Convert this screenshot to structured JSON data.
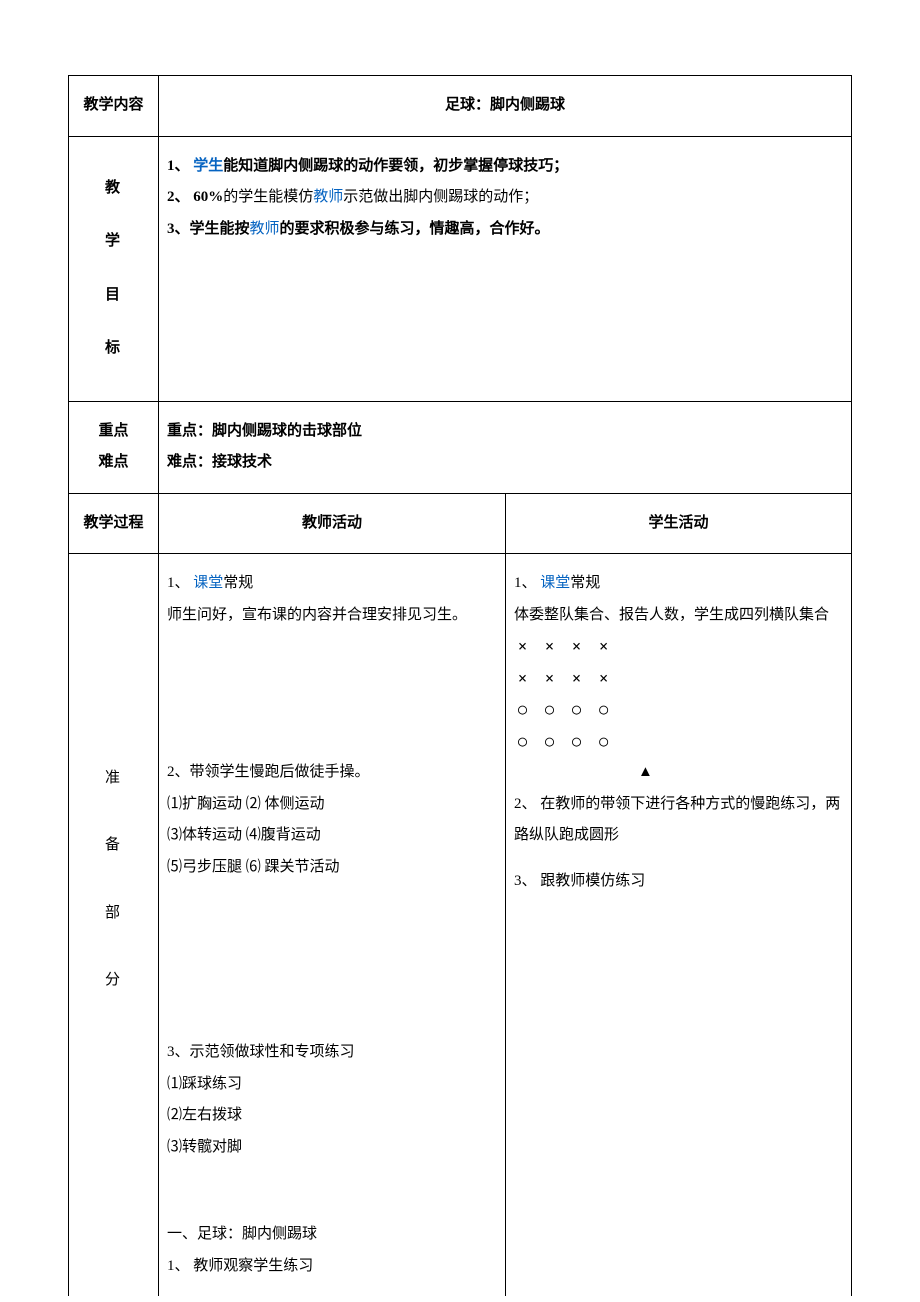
{
  "r1": {
    "label": "教学内容",
    "title": "足球：脚内侧踢球"
  },
  "r2": {
    "label1": "教",
    "label2": "学",
    "label3": "目",
    "label4": "标",
    "g1a": "1、 ",
    "g1link": "学生",
    "g1b": "能知道脚内侧踢球的动作要领，初步掌握停球技巧；",
    "g2a": "2、  60%",
    "g2b": "的学生能模仿",
    "g2link": "教师",
    "g2c": "示范做出脚内侧踢球的动作；",
    "g3a": "3、学生能按",
    "g3link": "教师",
    "g3b": "的要求积极参与练习，情趣高，合作好。"
  },
  "r3": {
    "label1": "重点",
    "label2": "难点",
    "l1": "重点：脚内侧踢球的击球部位",
    "l2": "难点：接球技术"
  },
  "r4": {
    "h1": "教学过程",
    "h2": "教师活动",
    "h3": "学生活动"
  },
  "prep": {
    "lab1": "准",
    "lab2": "备",
    "lab3": "部",
    "lab4": "分",
    "t1a": "1、  ",
    "t1link": "课堂",
    "t1b": "常规",
    "t1c": "师生问好，宣布课的内容并合理安排见习生。",
    "t2": "2、带领学生慢跑后做徒手操。",
    "t2a": "⑴扩胸运动 ⑵ 体侧运动",
    "t2b": "⑶体转运动   ⑷腹背运动",
    "t2c": "⑸弓步压腿 ⑹ 踝关节活动",
    "t3": "3、示范领做球性和专项练习",
    "t3a": "⑴踩球练习",
    "t3b": " ⑵左右拨球",
    "t3c": "⑶转髋对脚",
    "s1a": "1、  ",
    "s1link": "课堂",
    "s1b": "常规",
    "s1c": "体委整队集合、报告人数，学生成四列横队集合",
    "row_x": "××××",
    "row_o": "○○○○",
    "tri": "▲",
    "s2": "2、   在教师的带领下进行各种方式的慢跑练习，两路纵队跑成圆形",
    "s3": "3、   跟教师模仿练习"
  },
  "bottom": {
    "b1": " 一、足球：脚内侧踢球",
    "b2": "1、   教师观察学生练习"
  }
}
